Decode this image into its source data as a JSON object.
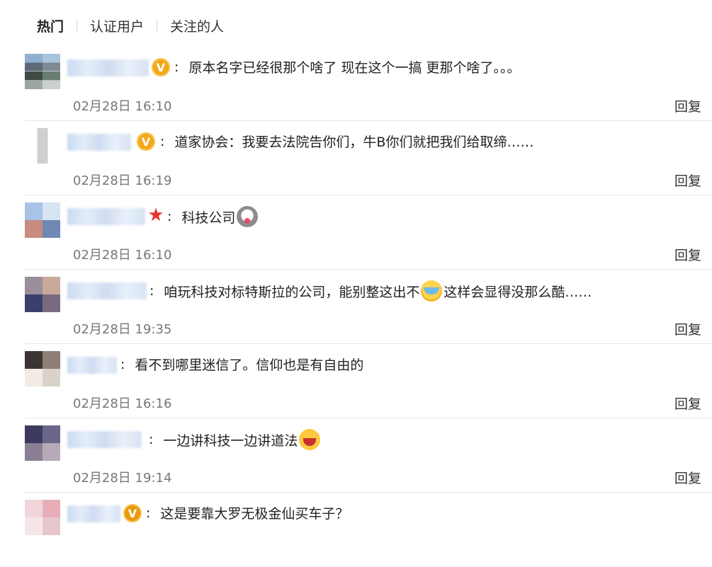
{
  "tabs": [
    {
      "label": "热门",
      "active": true
    },
    {
      "label": "认证用户",
      "active": false
    },
    {
      "label": "关注的人",
      "active": false
    }
  ],
  "comments": [
    {
      "badge": "V",
      "text": "原本名字已经很那个啥了 现在这个一搞 更那个啥了。。。",
      "time": "02月28日 16:10",
      "reply": "回复"
    },
    {
      "badge": "V",
      "text": "道家协会：我要去法院告你们，牛B你们就把我们给取缔……",
      "time": "02月28日 16:19",
      "reply": "回复"
    },
    {
      "badge": "star",
      "text": "科技公司",
      "emoji": "dog-face-icon",
      "time": "02月28日 16:10",
      "reply": "回复"
    },
    {
      "badge": "",
      "text_a": "咱玩科技对标特斯拉的公司，能别整这出不",
      "emoji": "crying-laughing-icon",
      "text_b": "这样会显得没那么酷……",
      "time": "02月28日 19:35",
      "reply": "回复"
    },
    {
      "badge": "",
      "text": "看不到哪里迷信了。信仰也是有自由的",
      "time": "02月28日 16:16",
      "reply": "回复"
    },
    {
      "badge": "",
      "text": "一边讲科技一边讲道法",
      "emoji": "laughing-face-icon",
      "time": "02月28日 19:14",
      "reply": "回复"
    },
    {
      "badge": "V",
      "text": "这是要靠大罗无极金仙买车子？"
    }
  ],
  "colors": {
    "badge_gold": "#f2a81b",
    "star_red": "#e8352a",
    "divider": "#e6e6e6"
  }
}
